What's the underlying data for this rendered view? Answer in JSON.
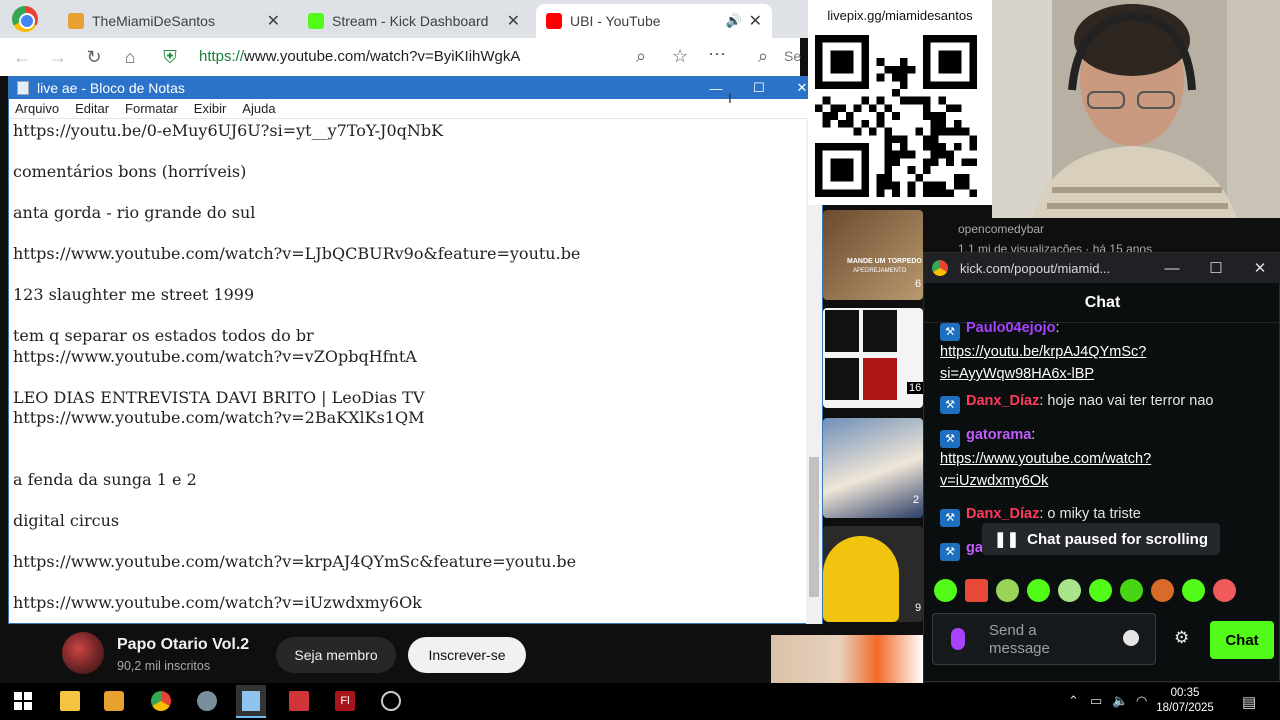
{
  "browser": {
    "tabs": [
      {
        "title": "TheMiamiDeSantos",
        "active": false
      },
      {
        "title": "Stream - Kick Dashboard",
        "active": false
      },
      {
        "title": "UBI - YouTube",
        "active": true
      }
    ],
    "url_scheme": "https://",
    "url_rest": "www.youtube.com/watch?v=ByiKIihWgkA",
    "search_partial": "Se"
  },
  "notepad": {
    "title": "live ae - Bloco de Notas",
    "menu": [
      "Arquivo",
      "Editar",
      "Formatar",
      "Exibir",
      "Ajuda"
    ],
    "lines": [
      "https://youtu.be/0-eMuy6UJ6U?si=yt__y7ToY-J0qNbK",
      "",
      "comentários bons (horríveis)",
      "",
      "anta gorda - rio grande do sul",
      "",
      "https://www.youtube.com/watch?v=LJbQCBURv9o&feature=youtu.be",
      "",
      "123 slaughter me street 1999",
      "",
      "tem q separar os estados todos do br",
      "https://www.youtube.com/watch?v=vZOpbqHfntA",
      "",
      "LEO DIAS ENTREVISTA DAVI BRITO | LeoDias TV",
      "https://www.youtube.com/watch?v=2BaKXlKs1QM",
      "",
      "",
      "a fenda da sunga 1 e 2",
      "",
      "digital circus",
      "",
      "https://www.youtube.com/watch?v=krpAJ4QYmSc&feature=youtu.be",
      "",
      "https://www.youtube.com/watch?v=iUzwdxmy6Ok"
    ]
  },
  "livepix": {
    "label": "livepix.gg/miamidesantos"
  },
  "youtube_side": {
    "channel_partial": "opencomedybar",
    "views_partial": "1,1 mi de visualizações · há 15 anos",
    "thumb_texts": [
      "MANDE UM TORPEDO",
      "APEDREJAMENTO"
    ],
    "thumb_labels": [
      "6",
      "16",
      "2",
      "9"
    ]
  },
  "kick": {
    "window_title": "kick.com/popout/miamid...",
    "chat_title": "Chat",
    "messages": [
      {
        "user": "Paulo04ejojo",
        "user_color": "#a742ff",
        "text": "",
        "link": "https://youtu.be/krpAJ4QYmSc?si=AyyWqw98HA6x-lBP"
      },
      {
        "user": "Danx_Díaz",
        "user_color": "#ff3b5c",
        "text": "hoje nao vai ter terror nao",
        "link": ""
      },
      {
        "user": "gatorama",
        "user_color": "#c35cff",
        "text": "",
        "link": "https://www.youtube.com/watch?v=iUzwdxmy6Ok"
      },
      {
        "user": "Danx_Díaz",
        "user_color": "#ff3b5c",
        "text": "o miky ta triste",
        "link": ""
      },
      {
        "user": "ga",
        "user_color": "#c35cff",
        "text": "",
        "link": ""
      }
    ],
    "paused_label": "Chat paused for scrolling",
    "send_placeholder": "Send a message",
    "send_button": "Chat"
  },
  "channel": {
    "name": "Papo Otario Vol.2",
    "subs": "90,2 mil inscritos",
    "join": "Seja membro",
    "subscribe": "Inscrever-se"
  },
  "taskbar": {
    "time": "00:35",
    "date": "18/07/2025"
  },
  "colors": {
    "kick_green": "#53fc18",
    "notepad_title": "#2b73c8",
    "youtube_dark": "#0f0f0f"
  }
}
